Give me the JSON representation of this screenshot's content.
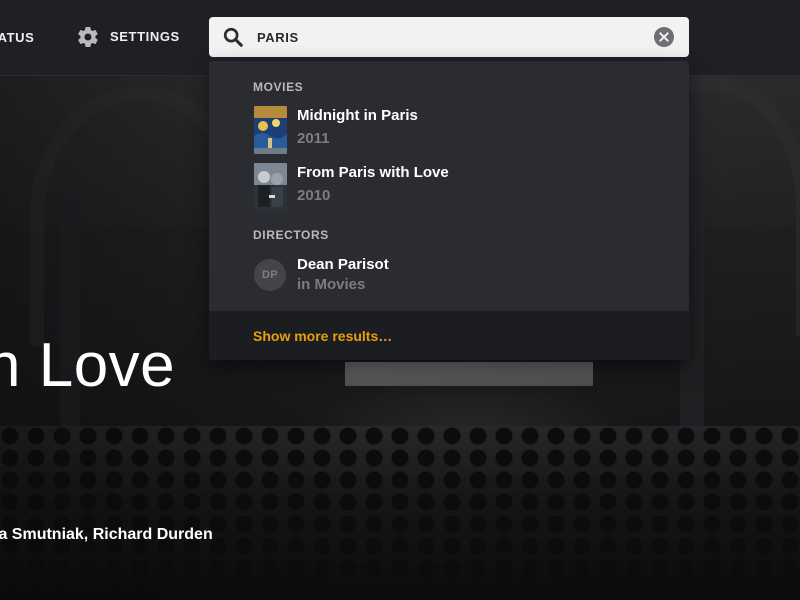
{
  "hero": {
    "title": "h Love",
    "cast": "ia Smutniak, Richard Durden"
  },
  "nav": {
    "status_label": "TATUS",
    "settings_label": "SETTINGS",
    "settings_icon": "gear-icon"
  },
  "search": {
    "value": "PARIS",
    "icon": "search-icon",
    "clear_icon": "clear-icon"
  },
  "dropdown": {
    "movies_header": "MOVIES",
    "movies": [
      {
        "title": "Midnight in Paris",
        "subtitle": "2011"
      },
      {
        "title": "From Paris with Love",
        "subtitle": "2010"
      }
    ],
    "directors_header": "DIRECTORS",
    "directors": [
      {
        "initials": "DP",
        "name": "Dean Parisot",
        "subtitle": "in Movies"
      }
    ],
    "show_more": "Show more results…"
  },
  "colors": {
    "accent": "#e5a00d",
    "topbar": "#1f2024",
    "dropdown": "#2b2c32",
    "dropdown_footer": "#1c1d21",
    "muted_text": "#7c7d82"
  }
}
